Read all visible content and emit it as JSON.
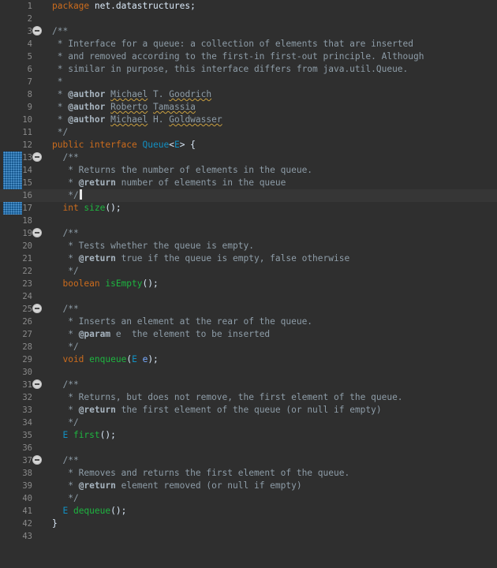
{
  "editor": {
    "language": "java",
    "current_line": 16,
    "modified_lines": [
      13,
      14,
      15,
      16,
      17
    ],
    "folded_lines": [
      3,
      13,
      19,
      25,
      31,
      37
    ],
    "lines": [
      {
        "n": "1",
        "tokens": [
          [
            "kw",
            "package"
          ],
          [
            "id",
            " net.datastructures;"
          ]
        ]
      },
      {
        "n": "2",
        "tokens": []
      },
      {
        "n": "3",
        "tokens": [
          [
            "cm",
            "/**"
          ]
        ]
      },
      {
        "n": "4",
        "tokens": [
          [
            "cm",
            " * Interface for a queue: a collection of elements that are inserted"
          ]
        ]
      },
      {
        "n": "5",
        "tokens": [
          [
            "cm",
            " * and removed according to the first-in first-out principle. Although"
          ]
        ]
      },
      {
        "n": "6",
        "tokens": [
          [
            "cm",
            " * similar in purpose, this interface differs from java.util.Queue."
          ]
        ]
      },
      {
        "n": "7",
        "tokens": [
          [
            "cm",
            " *"
          ]
        ]
      },
      {
        "n": "8",
        "tokens": [
          [
            "cm",
            " * "
          ],
          [
            "tag",
            "@author"
          ],
          [
            "cm",
            " "
          ],
          [
            "sq",
            "Michael"
          ],
          [
            "cm",
            " T. "
          ],
          [
            "sq",
            "Goodrich"
          ]
        ]
      },
      {
        "n": "9",
        "tokens": [
          [
            "cm",
            " * "
          ],
          [
            "tag",
            "@author"
          ],
          [
            "cm",
            " "
          ],
          [
            "sq",
            "Roberto"
          ],
          [
            "cm",
            " "
          ],
          [
            "sq",
            "Tamassia"
          ]
        ]
      },
      {
        "n": "10",
        "tokens": [
          [
            "cm",
            " * "
          ],
          [
            "tag",
            "@author"
          ],
          [
            "cm",
            " "
          ],
          [
            "sq",
            "Michael"
          ],
          [
            "cm",
            " H. "
          ],
          [
            "sq",
            "Goldwasser"
          ]
        ]
      },
      {
        "n": "11",
        "tokens": [
          [
            "cm",
            " */"
          ]
        ]
      },
      {
        "n": "12",
        "tokens": [
          [
            "kw",
            "public interface "
          ],
          [
            "type",
            "Queue"
          ],
          [
            "id",
            "<"
          ],
          [
            "type",
            "E"
          ],
          [
            "id",
            "> {"
          ]
        ]
      },
      {
        "n": "13",
        "tokens": [
          [
            "cm",
            "  /**"
          ]
        ]
      },
      {
        "n": "14",
        "tokens": [
          [
            "cm",
            "   * Returns the number of elements in the queue."
          ]
        ]
      },
      {
        "n": "15",
        "tokens": [
          [
            "cm",
            "   * "
          ],
          [
            "tag",
            "@return"
          ],
          [
            "cm",
            " number of elements in the queue"
          ]
        ]
      },
      {
        "n": "16",
        "tokens": [
          [
            "cm",
            "   */"
          ]
        ],
        "caret": true
      },
      {
        "n": "17",
        "tokens": [
          [
            "kw",
            "  int "
          ],
          [
            "fn",
            "size"
          ],
          [
            "id",
            "();"
          ]
        ]
      },
      {
        "n": "18",
        "tokens": []
      },
      {
        "n": "19",
        "tokens": [
          [
            "cm",
            "  /**"
          ]
        ]
      },
      {
        "n": "20",
        "tokens": [
          [
            "cm",
            "   * Tests whether the queue is empty."
          ]
        ]
      },
      {
        "n": "21",
        "tokens": [
          [
            "cm",
            "   * "
          ],
          [
            "tag",
            "@return"
          ],
          [
            "cm",
            " true if the queue is empty, false otherwise"
          ]
        ]
      },
      {
        "n": "22",
        "tokens": [
          [
            "cm",
            "   */"
          ]
        ]
      },
      {
        "n": "23",
        "tokens": [
          [
            "kw",
            "  boolean "
          ],
          [
            "fn",
            "isEmpty"
          ],
          [
            "id",
            "();"
          ]
        ]
      },
      {
        "n": "24",
        "tokens": []
      },
      {
        "n": "25",
        "tokens": [
          [
            "cm",
            "  /**"
          ]
        ]
      },
      {
        "n": "26",
        "tokens": [
          [
            "cm",
            "   * Inserts an element at the rear of the queue."
          ]
        ]
      },
      {
        "n": "27",
        "tokens": [
          [
            "cm",
            "   * "
          ],
          [
            "tag",
            "@param"
          ],
          [
            "cm",
            " e  the element to be inserted"
          ]
        ]
      },
      {
        "n": "28",
        "tokens": [
          [
            "cm",
            "   */"
          ]
        ]
      },
      {
        "n": "29",
        "tokens": [
          [
            "kw",
            "  void "
          ],
          [
            "fn",
            "enqueue"
          ],
          [
            "id",
            "("
          ],
          [
            "type",
            "E"
          ],
          [
            "id",
            " "
          ],
          [
            "var",
            "e"
          ],
          [
            "id",
            ");"
          ]
        ]
      },
      {
        "n": "30",
        "tokens": []
      },
      {
        "n": "31",
        "tokens": [
          [
            "cm",
            "  /**"
          ]
        ]
      },
      {
        "n": "32",
        "tokens": [
          [
            "cm",
            "   * Returns, but does not remove, the first element of the queue."
          ]
        ]
      },
      {
        "n": "33",
        "tokens": [
          [
            "cm",
            "   * "
          ],
          [
            "tag",
            "@return"
          ],
          [
            "cm",
            " the first element of the queue (or null if empty)"
          ]
        ]
      },
      {
        "n": "34",
        "tokens": [
          [
            "cm",
            "   */"
          ]
        ]
      },
      {
        "n": "35",
        "tokens": [
          [
            "type",
            "  E "
          ],
          [
            "fn",
            "first"
          ],
          [
            "id",
            "();"
          ]
        ]
      },
      {
        "n": "36",
        "tokens": []
      },
      {
        "n": "37",
        "tokens": [
          [
            "cm",
            "  /**"
          ]
        ]
      },
      {
        "n": "38",
        "tokens": [
          [
            "cm",
            "   * Removes and returns the first element of the queue."
          ]
        ]
      },
      {
        "n": "39",
        "tokens": [
          [
            "cm",
            "   * "
          ],
          [
            "tag",
            "@return"
          ],
          [
            "cm",
            " element removed (or null if empty)"
          ]
        ]
      },
      {
        "n": "40",
        "tokens": [
          [
            "cm",
            "   */"
          ]
        ]
      },
      {
        "n": "41",
        "tokens": [
          [
            "type",
            "  E "
          ],
          [
            "fn",
            "dequeue"
          ],
          [
            "id",
            "();"
          ]
        ]
      },
      {
        "n": "42",
        "tokens": [
          [
            "id",
            "}"
          ]
        ]
      },
      {
        "n": "43",
        "tokens": []
      }
    ]
  }
}
